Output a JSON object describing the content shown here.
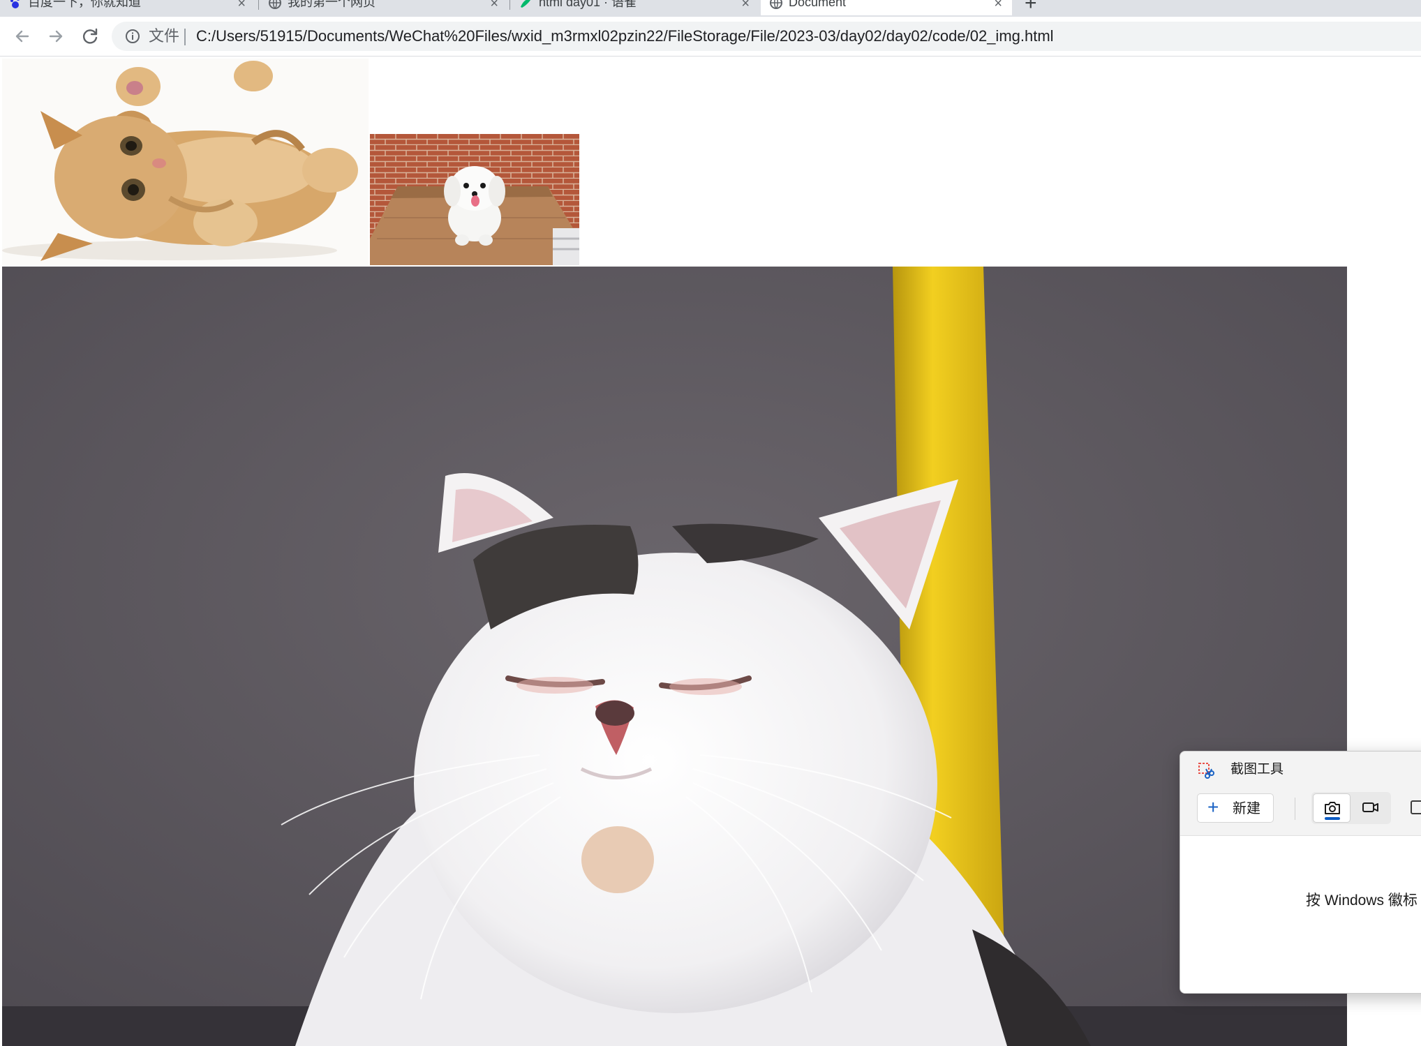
{
  "browser": {
    "tabs": [
      {
        "label": "百度一下，你就知道",
        "icon": "baidu-paw-icon"
      },
      {
        "label": "我的第一个网页",
        "icon": "globe-icon"
      },
      {
        "label": "html day01 · 语雀",
        "icon": "yuque-icon"
      },
      {
        "label": "Document",
        "icon": "globe-icon",
        "active": true
      }
    ],
    "new_tab_label": "+",
    "close_label": "×",
    "omnibox": {
      "chip": "文件",
      "url": "C:/Users/51915/Documents/WeChat%20Files/wxid_m3rmxl02pzin22/FileStorage/File/2023-03/day02/day02/code/02_img.html"
    }
  },
  "page": {
    "images": [
      {
        "subject": "kitten lying on its back",
        "icon": "kitten-photo"
      },
      {
        "subject": "white puppy on wooden table",
        "icon": "puppy-photo"
      },
      {
        "subject": "white exotic shorthair cat with eyes closed",
        "icon": "sleepy-cat-photo"
      }
    ]
  },
  "snipping_tool": {
    "title": "截图工具",
    "new_button": "新建",
    "hint": "按 Windows 徽标"
  },
  "colors": {
    "tab_strip": "#dee1e6",
    "omnibox": "#f1f3f4",
    "accent_blue": "#0b5cc4",
    "photo_backdrop": "#5d585f",
    "pole_yellow": "#e6c11a"
  }
}
